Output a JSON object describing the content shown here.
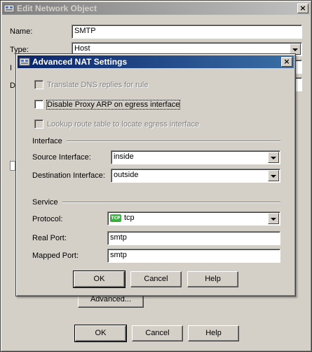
{
  "window": {
    "title": "Edit Network Object",
    "close_glyph": "×",
    "fields": {
      "name_label": "Name:",
      "name_value": "SMTP",
      "type_label": "Type:",
      "type_value": "Host",
      "ip_label_partial": "I",
      "desc_label_partial": "D"
    },
    "advanced_button": "Advanced...",
    "ok": "OK",
    "cancel": "Cancel",
    "help": "Help"
  },
  "dialog": {
    "title": "Advanced NAT Settings",
    "close_glyph": "×",
    "checkboxes": {
      "translate_dns": "Translate DNS replies for rule",
      "disable_proxy_arp": "Disable Proxy ARP on egress interface",
      "lookup_route": "Lookup route table to locate egress interface"
    },
    "interface_group": "Interface",
    "source_interface_label": "Source Interface:",
    "source_interface_value": "inside",
    "destination_interface_label": "Destination Interface:",
    "destination_interface_value": "outside",
    "service_group": "Service",
    "protocol_label": "Protocol:",
    "protocol_icon_text": "TCP",
    "protocol_value": "tcp",
    "real_port_label": "Real Port:",
    "real_port_value": "smtp",
    "mapped_port_label": "Mapped Port:",
    "mapped_port_value": "smtp",
    "ok": "OK",
    "cancel": "Cancel",
    "help": "Help"
  },
  "colors": {
    "active_title_start": "#0a246a",
    "active_title_end": "#3a6ea5",
    "inactive_title_start": "#808080",
    "face": "#d4d0c8"
  }
}
